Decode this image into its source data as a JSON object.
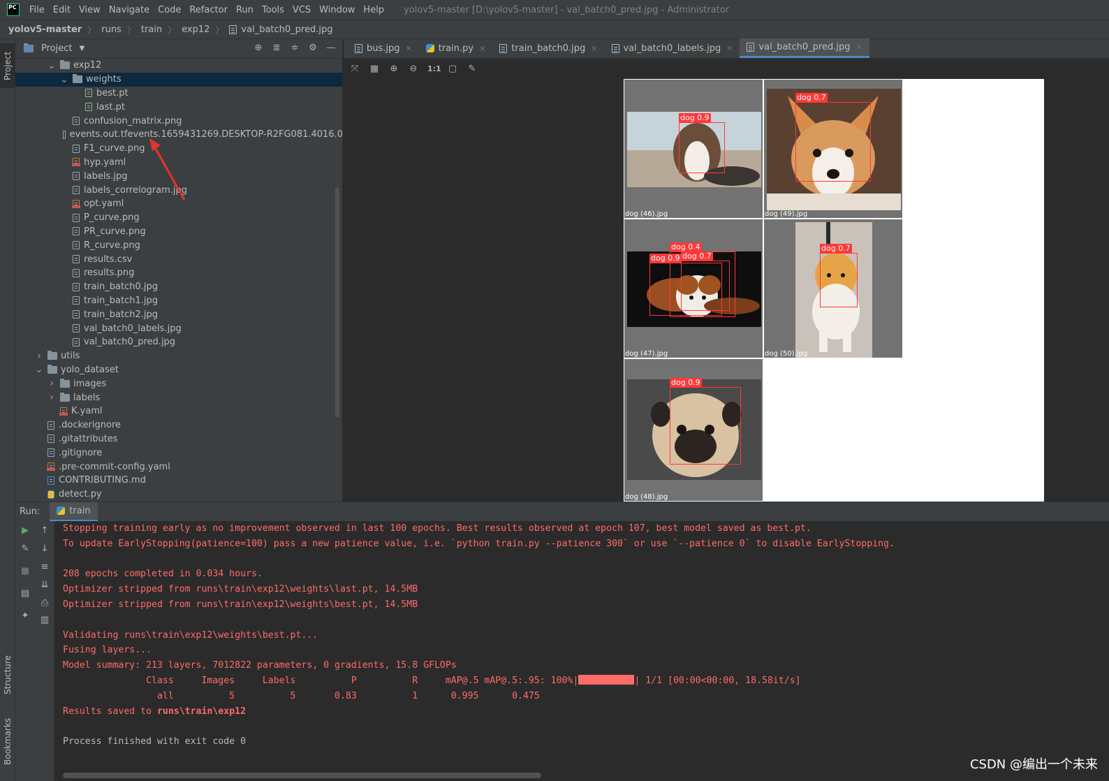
{
  "menubar": {
    "logo": "PC",
    "items": [
      "File",
      "Edit",
      "View",
      "Navigate",
      "Code",
      "Refactor",
      "Run",
      "Tools",
      "VCS",
      "Window",
      "Help"
    ],
    "window_title": "yolov5-master [D:\\yolov5-master] - val_batch0_pred.jpg - Administrator"
  },
  "breadcrumb": [
    "yolov5-master",
    "runs",
    "train",
    "exp12",
    "val_batch0_pred.jpg"
  ],
  "left_strip": {
    "project_tab": "Project",
    "structure_tab": "Structure",
    "bookmarks_tab": "Bookmarks"
  },
  "project_panel": {
    "title": "Project",
    "tool_icons": [
      "locate-icon",
      "expand-all-icon",
      "collapse-all-icon",
      "gear-icon",
      "minimize-icon"
    ],
    "tree": [
      {
        "label": "exp12",
        "kind": "folder",
        "depth": 2,
        "arrow": "down"
      },
      {
        "label": "weights",
        "kind": "folder",
        "depth": 3,
        "arrow": "down",
        "selected": true
      },
      {
        "label": "best.pt",
        "kind": "pt",
        "depth": 4
      },
      {
        "label": "last.pt",
        "kind": "pt",
        "depth": 4
      },
      {
        "label": "confusion_matrix.png",
        "kind": "file",
        "depth": 3
      },
      {
        "label": "events.out.tfevents.1659431269.DESKTOP-R2FG081.4016.0",
        "kind": "file",
        "depth": 3
      },
      {
        "label": "F1_curve.png",
        "kind": "file",
        "depth": 3
      },
      {
        "label": "hyp.yaml",
        "kind": "yaml",
        "depth": 3
      },
      {
        "label": "labels.jpg",
        "kind": "file",
        "depth": 3
      },
      {
        "label": "labels_correlogram.jpg",
        "kind": "file",
        "depth": 3
      },
      {
        "label": "opt.yaml",
        "kind": "yaml",
        "depth": 3
      },
      {
        "label": "P_curve.png",
        "kind": "file",
        "depth": 3
      },
      {
        "label": "PR_curve.png",
        "kind": "file",
        "depth": 3
      },
      {
        "label": "R_curve.png",
        "kind": "file",
        "depth": 3
      },
      {
        "label": "results.csv",
        "kind": "file",
        "depth": 3
      },
      {
        "label": "results.png",
        "kind": "file",
        "depth": 3
      },
      {
        "label": "train_batch0.jpg",
        "kind": "file",
        "depth": 3
      },
      {
        "label": "train_batch1.jpg",
        "kind": "file",
        "depth": 3
      },
      {
        "label": "train_batch2.jpg",
        "kind": "file",
        "depth": 3
      },
      {
        "label": "val_batch0_labels.jpg",
        "kind": "file",
        "depth": 3
      },
      {
        "label": "val_batch0_pred.jpg",
        "kind": "file",
        "depth": 3
      },
      {
        "label": "utils",
        "kind": "folder",
        "depth": 1,
        "arrow": "right"
      },
      {
        "label": "yolo_dataset",
        "kind": "folder",
        "depth": 1,
        "arrow": "down"
      },
      {
        "label": "images",
        "kind": "folder",
        "depth": 2,
        "arrow": "right"
      },
      {
        "label": "labels",
        "kind": "folder",
        "depth": 2,
        "arrow": "right"
      },
      {
        "label": "K.yaml",
        "kind": "yaml",
        "depth": 2
      },
      {
        "label": ".dockerignore",
        "kind": "file",
        "depth": 1
      },
      {
        "label": ".gitattributes",
        "kind": "file",
        "depth": 1
      },
      {
        "label": ".gitignore",
        "kind": "file",
        "depth": 1
      },
      {
        "label": ".pre-commit-config.yaml",
        "kind": "yaml",
        "depth": 1
      },
      {
        "label": "CONTRIBUTING.md",
        "kind": "md",
        "depth": 1
      },
      {
        "label": "detect.py",
        "kind": "py",
        "depth": 1
      }
    ]
  },
  "editor": {
    "tabs": [
      {
        "label": "bus.jpg",
        "active": false
      },
      {
        "label": "train.py",
        "active": false
      },
      {
        "label": "train_batch0.jpg",
        "active": false
      },
      {
        "label": "val_batch0_labels.jpg",
        "active": false
      },
      {
        "label": "val_batch0_pred.jpg",
        "active": true
      }
    ],
    "image_tools": [
      "fit-icon",
      "grid-icon",
      "zoom-in-icon",
      "zoom-out-icon",
      "actual-size-label",
      "background-icon",
      "color-picker-icon"
    ],
    "actual_size_label": "1:1",
    "tiles": [
      {
        "caption": "dog (46).jpg",
        "boxes": [
          {
            "label": "dog 0.9"
          }
        ]
      },
      {
        "caption": "dog (49).jpg",
        "boxes": [
          {
            "label": "dog 0.7"
          }
        ]
      },
      {
        "caption": "dog (47).jpg",
        "boxes": [
          {
            "label": "dog 0.4"
          },
          {
            "label": "dog 0.9"
          },
          {
            "label": "dog 0.7"
          }
        ]
      },
      {
        "caption": "dog (50).jpg",
        "boxes": [
          {
            "label": "dog 0.7"
          }
        ]
      },
      {
        "caption": "dog (48).jpg",
        "boxes": [
          {
            "label": "dog 0.9"
          }
        ]
      }
    ]
  },
  "run": {
    "title": "Run:",
    "tab_label": "train",
    "gutter_icons": [
      "rerun-icon",
      "up-arrow-icon",
      "wrench-icon",
      "down-arrow-icon",
      "stop-icon",
      "soft-wrap-icon",
      "scroll-to-end-icon",
      "layout-icon",
      "print-icon",
      "pin-icon",
      "trash-icon"
    ],
    "lines": [
      {
        "text": "Stopping training early as no improvement observed in last 100 epochs. Best results observed at epoch 107, best model saved as best.pt.",
        "color": "red"
      },
      {
        "text": "To update EarlyStopping(patience=100) pass a new patience value, i.e. `python train.py --patience 300` or use `--patience 0` to disable EarlyStopping.",
        "color": "red"
      },
      {
        "text": "",
        "color": "red"
      },
      {
        "text": "208 epochs completed in 0.034 hours.",
        "color": "red"
      },
      {
        "text": "Optimizer stripped from runs\\train\\exp12\\weights\\last.pt, 14.5MB",
        "color": "red"
      },
      {
        "text": "Optimizer stripped from runs\\train\\exp12\\weights\\best.pt, 14.5MB",
        "color": "red"
      },
      {
        "text": "",
        "color": "red"
      },
      {
        "text": "Validating runs\\train\\exp12\\weights\\best.pt...",
        "color": "red"
      },
      {
        "text": "Fusing layers...",
        "color": "red"
      },
      {
        "text": "Model summary: 213 layers, 7012822 parameters, 0 gradients, 15.8 GFLOPs",
        "color": "red"
      }
    ],
    "progress_line": {
      "prefix": "               Class     Images     Labels          P          R     mAP@.5 mAP@.5:.95: 100%|",
      "suffix": "| 1/1 [00:00<00:00, 18.58it/s]",
      "progress_fraction": 1.0
    },
    "all_line": "                 all          5          5       0.83          1      0.995      0.475",
    "results_prefix": "Results saved to ",
    "results_path": "runs\\train\\exp12",
    "blank": "",
    "exit_line": "Process finished with exit code 0"
  },
  "watermark": "CSDN @编出一个未来",
  "colors": {
    "bbox": "#ff3838",
    "console_error": "#ff6b68",
    "selection": "#0d293e",
    "accent": "#4a88c7"
  }
}
